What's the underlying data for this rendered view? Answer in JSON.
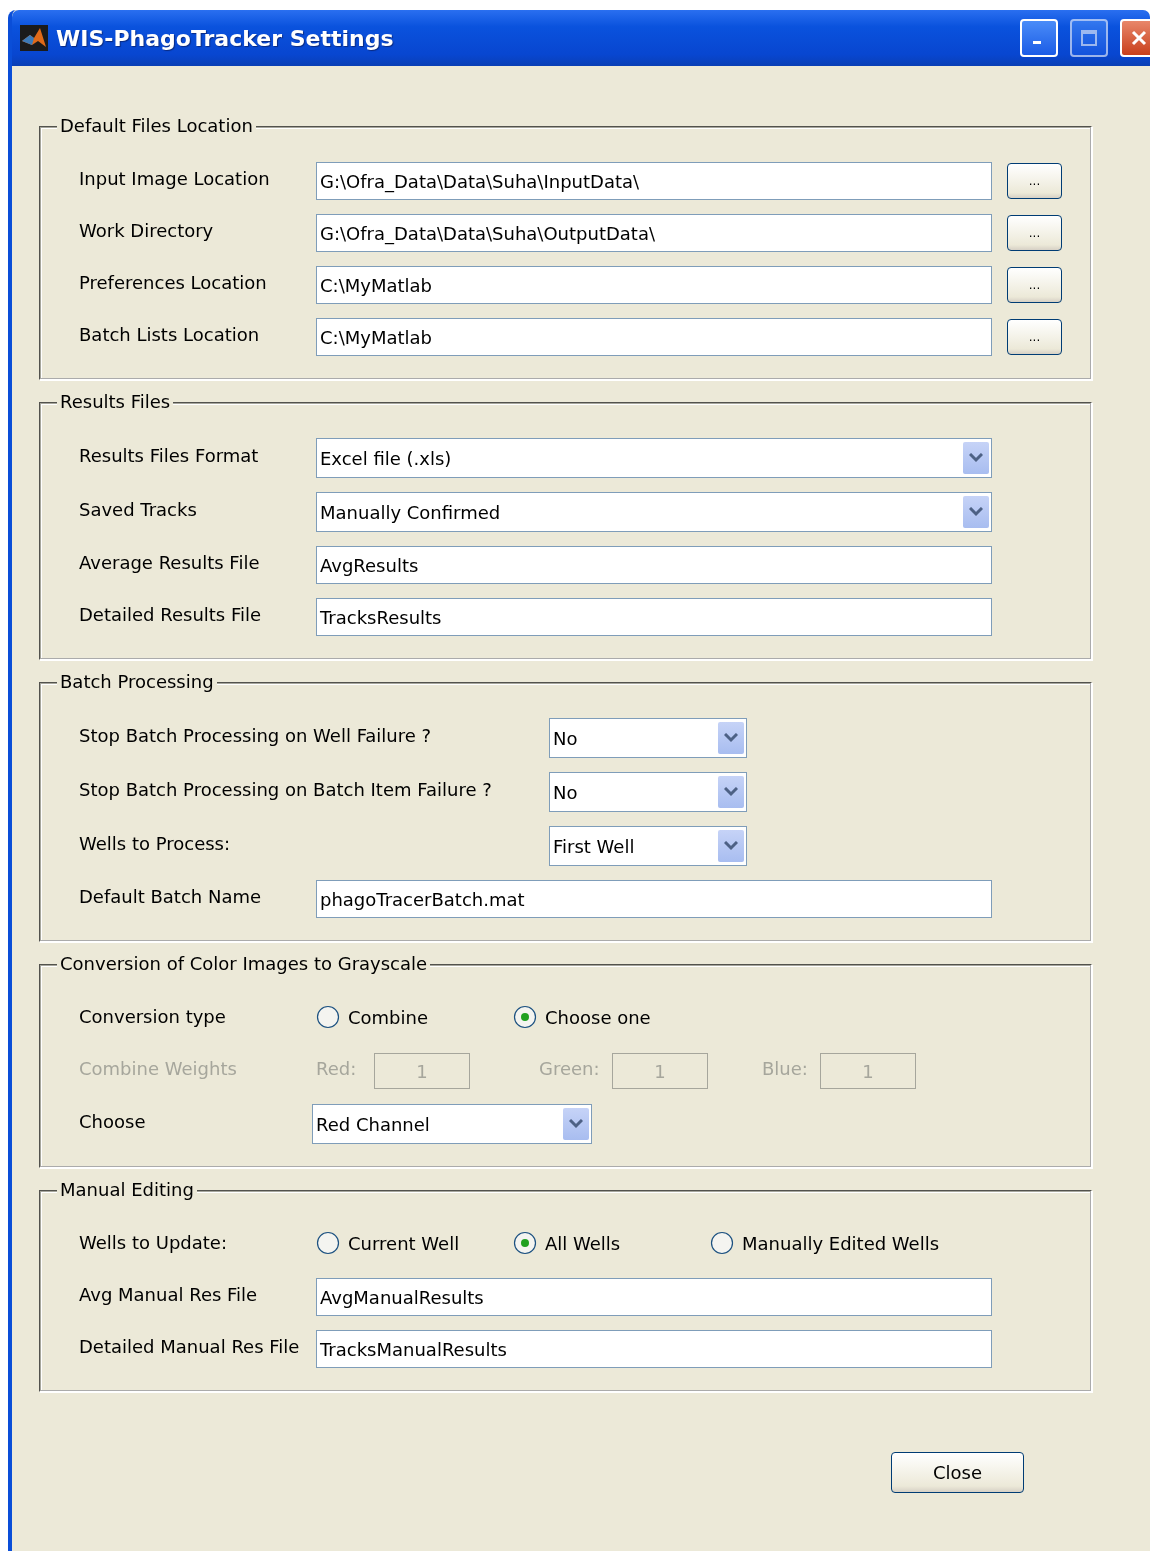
{
  "window": {
    "title": "WIS-PhagoTracker Settings"
  },
  "sections": [
    {
      "title": "Default Files Location",
      "rows": [
        {
          "kind": "path",
          "label": "Input Image Location",
          "value": "G:\\Ofra_Data\\Data\\Suha\\InputData\\",
          "button": "..."
        },
        {
          "kind": "path",
          "label": "Work Directory",
          "value": "G:\\Ofra_Data\\Data\\Suha\\OutputData\\",
          "button": "..."
        },
        {
          "kind": "path",
          "label": "Preferences Location",
          "value": "C:\\MyMatlab",
          "button": "..."
        },
        {
          "kind": "path",
          "label": "Batch Lists Location",
          "value": "C:\\MyMatlab",
          "button": "..."
        }
      ]
    },
    {
      "title": "Results Files",
      "rows": [
        {
          "kind": "select",
          "label": "Results Files Format",
          "value": "Excel file (.xls)"
        },
        {
          "kind": "select",
          "label": "Saved Tracks",
          "value": "Manually Confirmed"
        },
        {
          "kind": "text",
          "label": "Average Results File",
          "value": "AvgResults"
        },
        {
          "kind": "text",
          "label": "Detailed Results File",
          "value": "TracksResults"
        }
      ]
    },
    {
      "title": "Batch Processing",
      "rows": [
        {
          "kind": "short-select",
          "label": "Stop Batch Processing on Well Failure ?",
          "value": "No"
        },
        {
          "kind": "short-select",
          "label": "Stop Batch Processing on Batch Item Failure ?",
          "value": "No"
        },
        {
          "kind": "short-select",
          "label": "Wells to Process:",
          "value": "First Well"
        },
        {
          "kind": "text",
          "label": "Default Batch Name",
          "value": "phagoTracerBatch.mat"
        }
      ]
    },
    {
      "title": "Conversion of Color Images to Grayscale",
      "rows": [
        {
          "kind": "radios",
          "label": "Conversion type",
          "options": [
            {
              "label": "Combine",
              "selected": false
            },
            {
              "label": "Choose one",
              "selected": true
            }
          ]
        },
        {
          "kind": "weights",
          "label": "Combine Weights",
          "disabled": true,
          "weights": [
            {
              "label": "Red:",
              "value": "1"
            },
            {
              "label": "Green:",
              "value": "1"
            },
            {
              "label": "Blue:",
              "value": "1"
            }
          ]
        },
        {
          "kind": "mid-select",
          "label": "Choose",
          "value": "Red Channel"
        }
      ]
    },
    {
      "title": "Manual Editing",
      "rows": [
        {
          "kind": "radios",
          "label": "Wells to Update:",
          "options": [
            {
              "label": "Current Well",
              "selected": false
            },
            {
              "label": "All Wells",
              "selected": true
            },
            {
              "label": "Manually Edited Wells",
              "selected": false
            }
          ]
        },
        {
          "kind": "text",
          "label": "Avg Manual Res File",
          "value": "AvgManualResults"
        },
        {
          "kind": "text",
          "label": "Detailed Manual Res File",
          "value": "TracksManualResults"
        }
      ]
    }
  ],
  "close_button": "Close"
}
